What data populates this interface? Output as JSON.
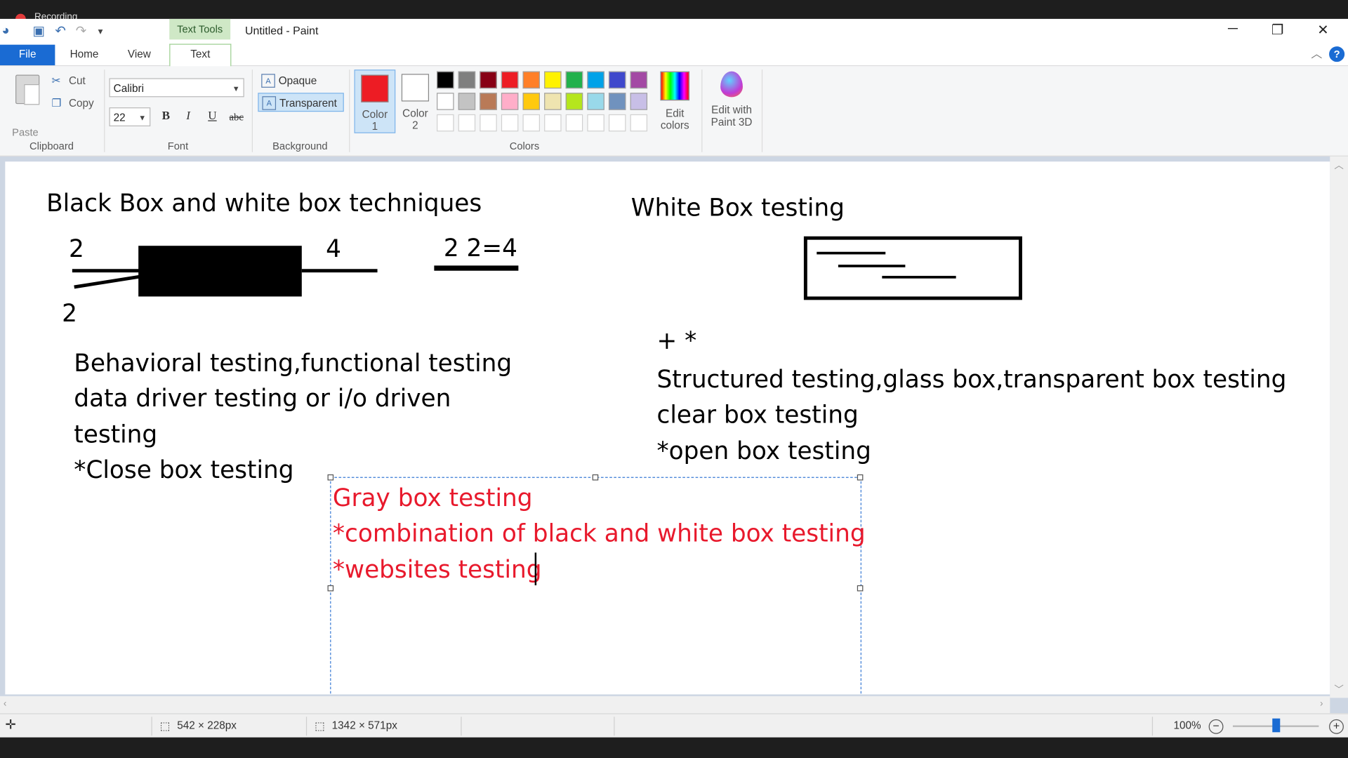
{
  "recording": {
    "label": "Recording"
  },
  "titlebar": {
    "context_tab": "Text Tools",
    "title": "Untitled - Paint"
  },
  "tabs": [
    {
      "label": "File"
    },
    {
      "label": "Home"
    },
    {
      "label": "View"
    },
    {
      "label": "Text"
    }
  ],
  "clipboard": {
    "paste": "Paste",
    "cut": "Cut",
    "copy": "Copy",
    "group": "Clipboard"
  },
  "font": {
    "family": "Calibri",
    "size": "22",
    "bold": "B",
    "italic": "I",
    "underline": "U",
    "strike": "abc",
    "group": "Font"
  },
  "background": {
    "opaque": "Opaque",
    "transparent": "Transparent",
    "group": "Background"
  },
  "colors": {
    "color1_label": "Color 1",
    "color2_label": "Color 2",
    "color1": "#ed1c24",
    "color2": "#ffffff",
    "palette_row1": [
      "#000000",
      "#7f7f7f",
      "#880015",
      "#ed1c24",
      "#ff7f27",
      "#fff200",
      "#22b14c",
      "#00a2e8",
      "#3f48cc",
      "#a349a4"
    ],
    "palette_row2": [
      "#ffffff",
      "#c3c3c3",
      "#b97a57",
      "#ffaec9",
      "#ffc90e",
      "#efe4b0",
      "#b5e61d",
      "#99d9ea",
      "#7092be",
      "#c8bfe7"
    ],
    "edit_colors": "Edit colors",
    "paint3d": "Edit with Paint 3D",
    "group": "Colors"
  },
  "canvas": {
    "heading_left": "Black Box and white box techniques",
    "heading_right": "White Box testing",
    "num_in_top": "2",
    "num_out": "4",
    "num_in_bottom": "2",
    "equation": "2  2=4",
    "plus_star": "+ *",
    "left_lines": [
      "Behavioral testing,functional testing",
      "data driver testing or i/o driven",
      "testing",
      "*Close box testing"
    ],
    "right_lines": [
      "Structured testing,glass box,transparent box testing",
      "clear box testing",
      "*open box testing"
    ],
    "red_lines": [
      "Gray box testing",
      "*combination of black and white box testing",
      "*websites testing"
    ]
  },
  "status": {
    "selection_size": "542 × 228px",
    "image_size": "1342 × 571px",
    "zoom": "100%"
  }
}
